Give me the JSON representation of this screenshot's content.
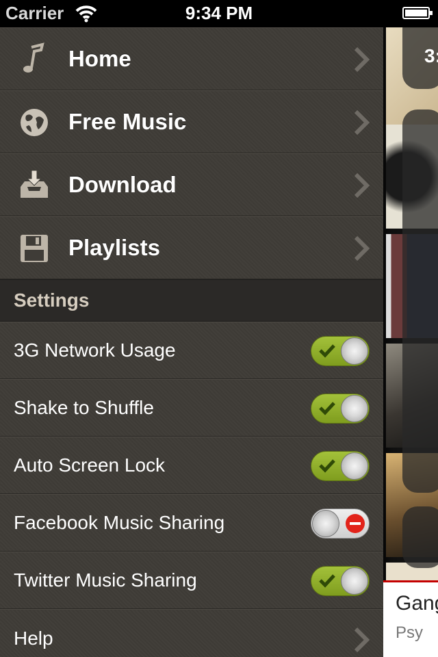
{
  "status_bar": {
    "carrier": "Carrier",
    "time": "9:34 PM"
  },
  "menu": {
    "items": [
      {
        "label": "Home",
        "icon": "music-note-icon"
      },
      {
        "label": "Free Music",
        "icon": "globe-icon"
      },
      {
        "label": "Download",
        "icon": "download-tray-icon"
      },
      {
        "label": "Playlists",
        "icon": "floppy-disk-icon"
      }
    ]
  },
  "settings": {
    "header": "Settings",
    "rows": [
      {
        "label": "3G Network Usage",
        "on": true
      },
      {
        "label": "Shake to Shuffle",
        "on": true
      },
      {
        "label": "Auto Screen Lock",
        "on": true
      },
      {
        "label": "Facebook Music Sharing",
        "on": false
      },
      {
        "label": "Twitter Music Sharing",
        "on": true
      }
    ],
    "help": "Help"
  },
  "peek": {
    "time_fragment": "3:",
    "now_playing_title": "Gang",
    "now_playing_artist": "Psy"
  },
  "colors": {
    "toggle_on": "#8fb02a",
    "toggle_off_minus": "#e2231a",
    "menu_bg": "#3f3c37",
    "now_playing_rule": "#c40000"
  }
}
